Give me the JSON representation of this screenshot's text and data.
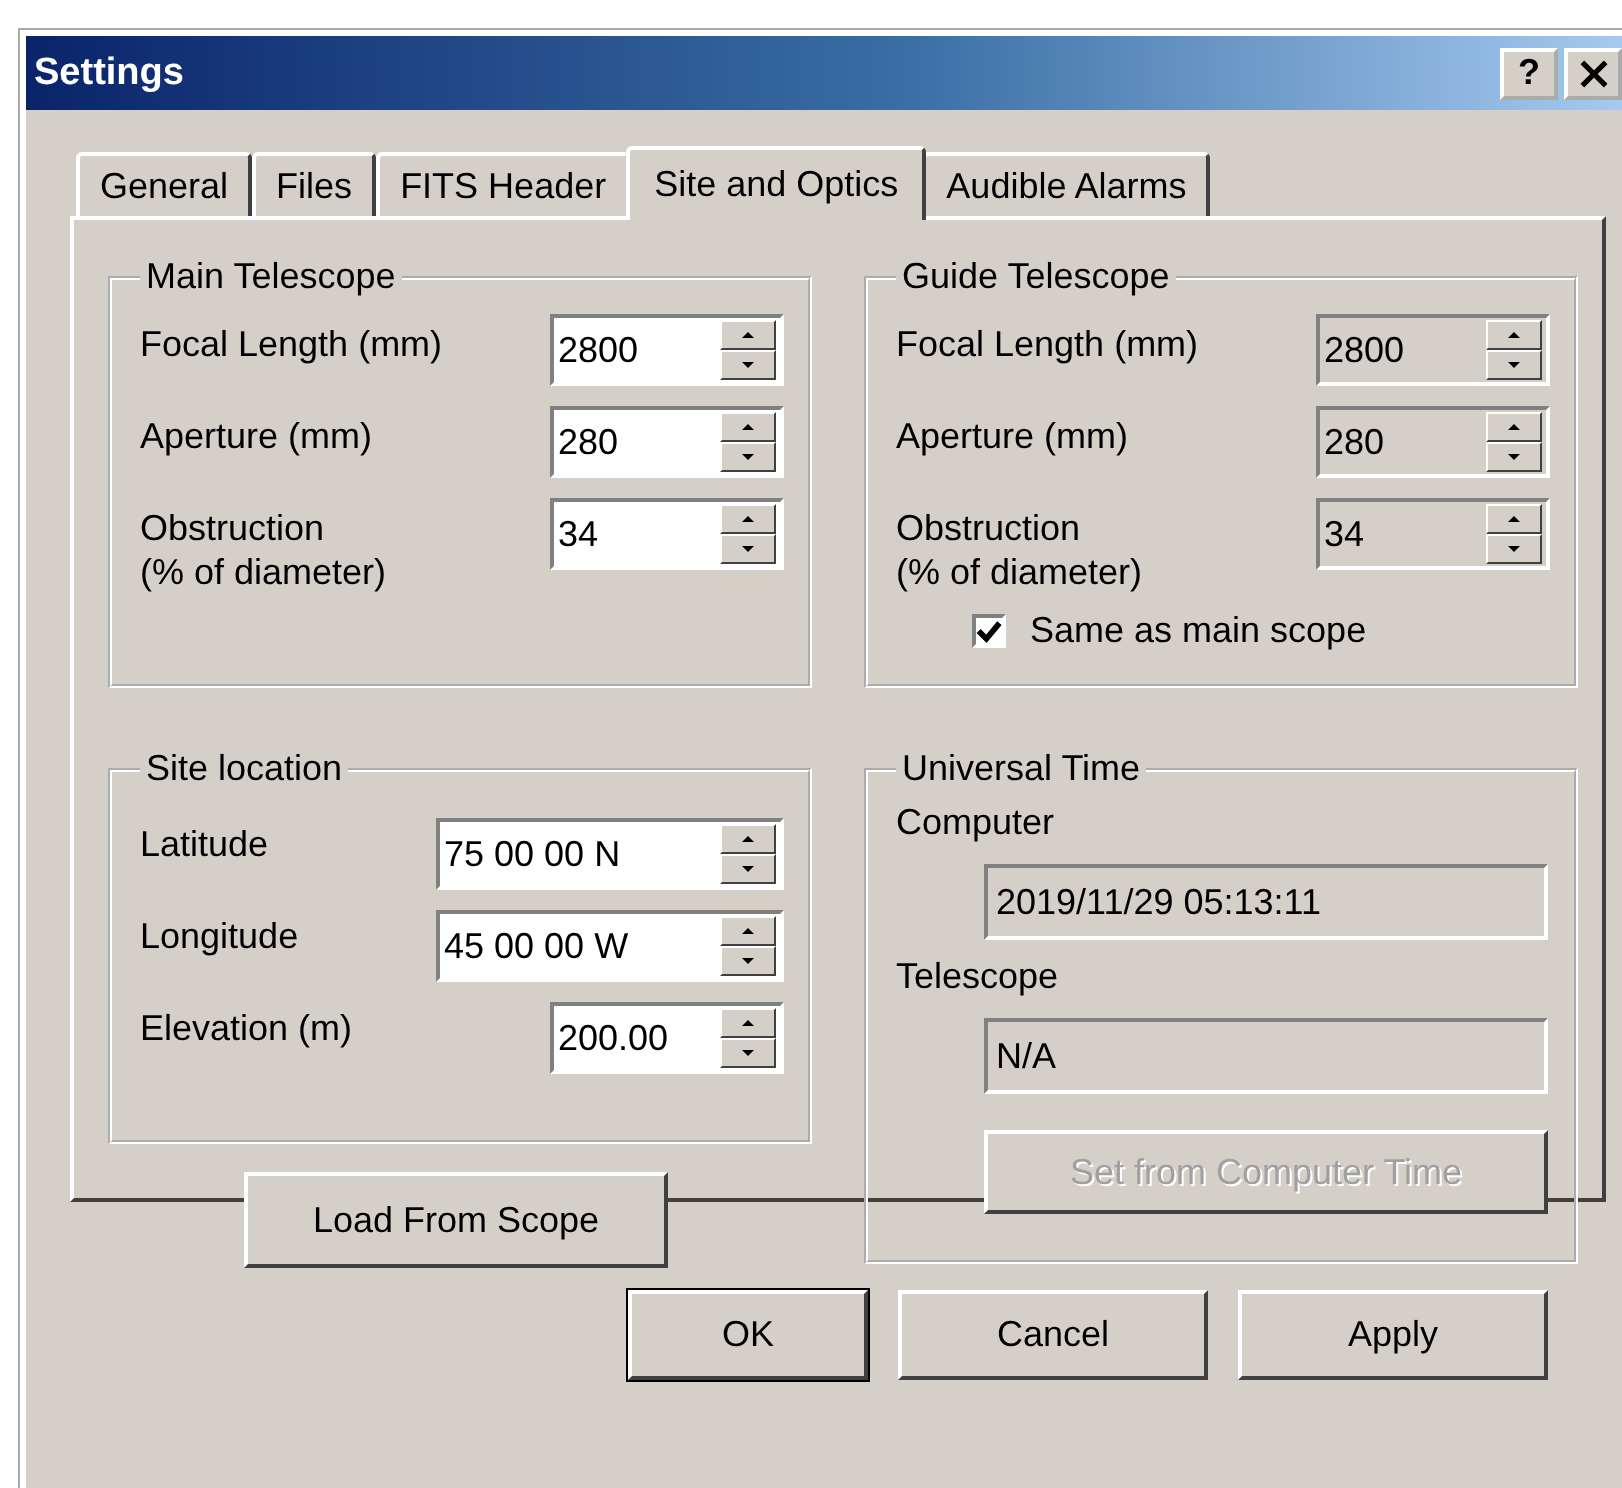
{
  "window": {
    "title": "Settings",
    "help_button": "?"
  },
  "tabs": [
    {
      "label": "General",
      "selected": false
    },
    {
      "label": "Files",
      "selected": false
    },
    {
      "label": "FITS Header",
      "selected": false
    },
    {
      "label": "Site and Optics",
      "selected": true
    },
    {
      "label": "Audible Alarms",
      "selected": false
    }
  ],
  "main_telescope": {
    "title": "Main Telescope",
    "fields": [
      {
        "label": "Focal Length (mm)",
        "value": "2800",
        "disabled": false
      },
      {
        "label": "Aperture (mm)",
        "value": "280",
        "disabled": false
      },
      {
        "label": "Obstruction\n(% of diameter)",
        "value": "34",
        "disabled": false
      }
    ]
  },
  "guide_telescope": {
    "title": "Guide Telescope",
    "fields": [
      {
        "label": "Focal Length (mm)",
        "value": "2800",
        "disabled": true
      },
      {
        "label": "Aperture (mm)",
        "value": "280",
        "disabled": true
      },
      {
        "label": "Obstruction\n(% of diameter)",
        "value": "34",
        "disabled": true
      }
    ],
    "checkbox": {
      "label": "Same as main scope",
      "checked": true
    }
  },
  "site_location": {
    "title": "Site location",
    "fields": [
      {
        "label": "Latitude",
        "value": "75 00 00 N",
        "disabled": false
      },
      {
        "label": "Longitude",
        "value": "45 00 00 W",
        "disabled": false
      },
      {
        "label": "Elevation (m)",
        "value": "200.00",
        "disabled": false
      }
    ]
  },
  "load_button": {
    "label": "Load From Scope",
    "disabled": false
  },
  "universal_time": {
    "title": "Universal Time",
    "fields": [
      {
        "label": "Computer",
        "value": "2019/11/29 05:13:11"
      },
      {
        "label": "Telescope",
        "value": "N/A"
      }
    ],
    "button": {
      "label": "Set from Computer Time",
      "disabled": true
    }
  },
  "buttons": [
    {
      "label": "OK",
      "default": true
    },
    {
      "label": "Cancel",
      "default": false
    },
    {
      "label": "Apply",
      "default": false
    }
  ]
}
